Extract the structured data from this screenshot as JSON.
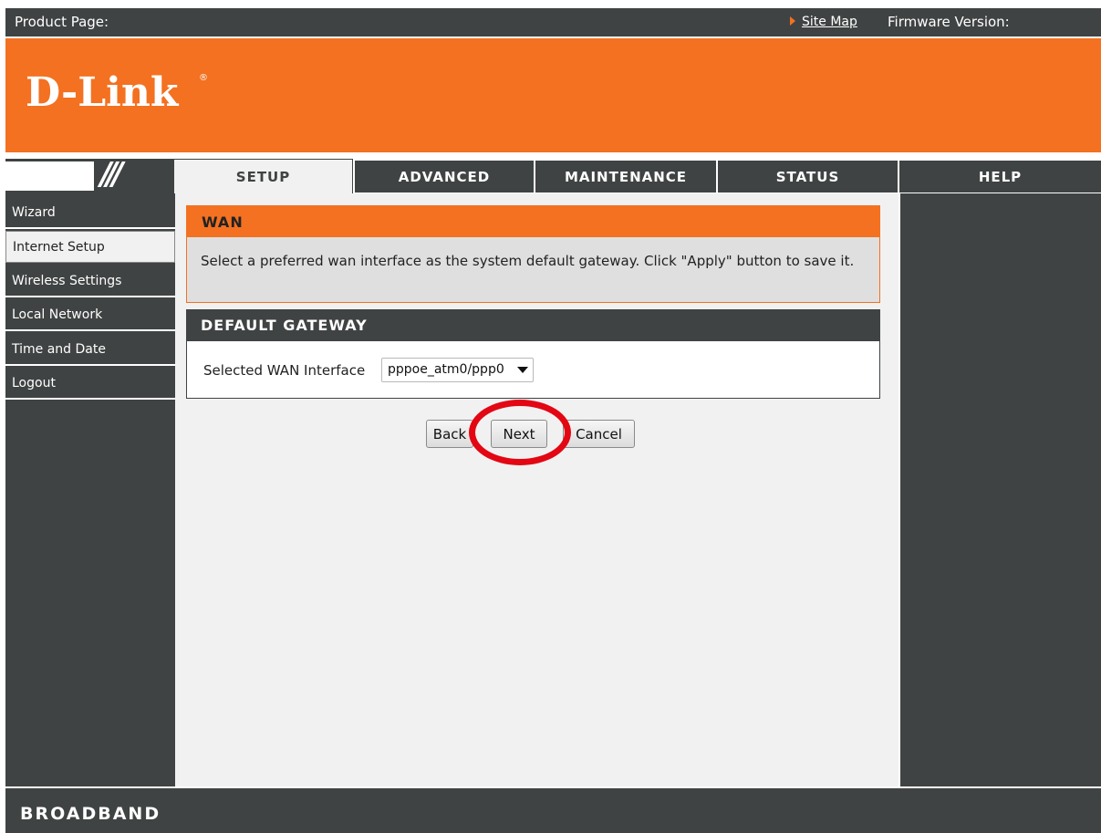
{
  "topbar": {
    "product_label": "Product Page:",
    "site_map": "Site Map",
    "firmware_label": "Firmware Version:"
  },
  "header": {
    "logo": "D-Link",
    "logo_reg": "®"
  },
  "brand_block": {
    "slashes": "///"
  },
  "tabs": [
    {
      "label": "SETUP",
      "active": true
    },
    {
      "label": "ADVANCED"
    },
    {
      "label": "MAINTENANCE"
    },
    {
      "label": "STATUS"
    },
    {
      "label": "HELP"
    }
  ],
  "sidebar": {
    "items": [
      {
        "label": "Wizard"
      },
      {
        "label": "Internet Setup",
        "selected": true
      },
      {
        "label": "Wireless Settings"
      },
      {
        "label": "Local Network"
      },
      {
        "label": "Time and Date"
      },
      {
        "label": "Logout"
      }
    ]
  },
  "wan": {
    "title": "WAN",
    "description": "Select a preferred wan interface as the system default gateway. Click \"Apply\" button to save it."
  },
  "gateway": {
    "title": "DEFAULT GATEWAY",
    "label": "Selected WAN Interface",
    "selected_value": "pppoe_atm0/ppp0"
  },
  "buttons": {
    "back": "Back",
    "next": "Next",
    "cancel": "Cancel"
  },
  "footer": {
    "brand": "BROADBAND"
  },
  "colors": {
    "accent": "#f37121",
    "dark": "#404343",
    "content_bg": "#f1f1f1",
    "highlight": "#e30613"
  }
}
